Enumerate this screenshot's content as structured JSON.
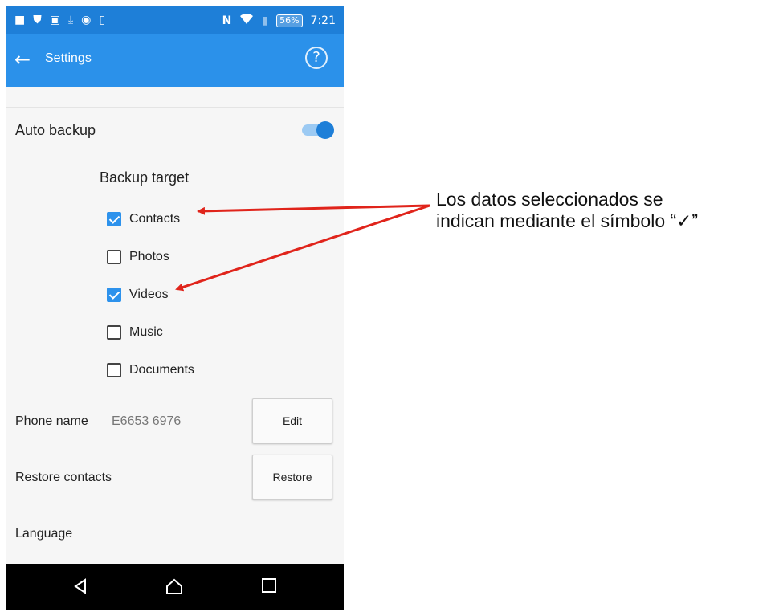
{
  "status_bar": {
    "left_icons": [
      "notification-icon",
      "shield-icon",
      "image-icon",
      "download-icon",
      "dot-icon",
      "sim-icon"
    ],
    "nfc": "N",
    "battery": "56%",
    "time": "7:21"
  },
  "app_bar": {
    "title": "Settings",
    "help_glyph": "?"
  },
  "auto_backup": {
    "label": "Auto backup",
    "enabled": true
  },
  "backup_target": {
    "heading": "Backup target",
    "items": [
      {
        "label": "Contacts",
        "checked": true
      },
      {
        "label": "Photos",
        "checked": false
      },
      {
        "label": "Videos",
        "checked": true
      },
      {
        "label": "Music",
        "checked": false
      },
      {
        "label": "Documents",
        "checked": false
      }
    ]
  },
  "phone_name": {
    "label": "Phone name",
    "value": "E6653 6976",
    "button": "Edit"
  },
  "restore_contacts": {
    "label": "Restore contacts",
    "button": "Restore"
  },
  "language": {
    "label": "Language"
  },
  "callout": {
    "line1": "Los datos seleccionados se",
    "line2": "indican mediante el símbolo “✓”"
  },
  "colors": {
    "status_bar": "#1e7fd8",
    "app_bar": "#2b91ea",
    "accent": "#2d92ec",
    "arrow": "#e0241b"
  }
}
